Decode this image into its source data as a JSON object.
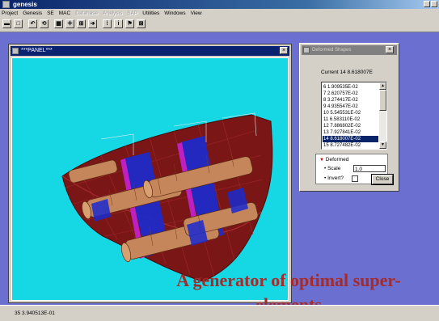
{
  "app": {
    "title": "genesis",
    "menus": [
      {
        "label": "Project",
        "enabled": true
      },
      {
        "label": "Genesis",
        "enabled": true
      },
      {
        "label": "SE",
        "enabled": true
      },
      {
        "label": "MAC",
        "enabled": true
      },
      {
        "label": "Database",
        "enabled": false
      },
      {
        "label": "Analysis",
        "enabled": false
      },
      {
        "label": "SAP",
        "enabled": false
      },
      {
        "label": "Utilities",
        "enabled": true
      },
      {
        "label": "Windows",
        "enabled": true
      },
      {
        "label": "View",
        "enabled": true
      }
    ]
  },
  "panel": {
    "title": "***PANEL***",
    "close_glyph": "×",
    "canvas_bg": "#16d8e4"
  },
  "dialog": {
    "title": "Deformed Shapes",
    "close_glyph": "×",
    "current_label": "Current  14  8.618007E",
    "list_items": [
      "6  1.909535E-02",
      "7  2.620757E-02",
      "8  3.274417E-02",
      "9  4.935547E-02",
      "10  5.545531E-02",
      "11  6.583110E-02",
      "12  7.886802E-02",
      "13  7.927841E-02",
      "14  8.618007E-02",
      "15  8.727482E-02"
    ],
    "selected_index": 8,
    "deformed_label": "Deformed",
    "scale_label": "Scale",
    "scale_value": "1.0",
    "invert_label": "Invert?",
    "close_button_label": "Close"
  },
  "caption": {
    "line1": "A generator of optimal super-",
    "line2": "elements",
    "color": "#a52a2a"
  },
  "status": {
    "text": "35  3.940513E-01"
  },
  "colors": {
    "desktop": "#6b6fd0",
    "hull": "#8b1a1a",
    "cylinder": "#c4865a",
    "frame_blue": "#1a2ad0",
    "frame_magenta": "#c020c0"
  }
}
